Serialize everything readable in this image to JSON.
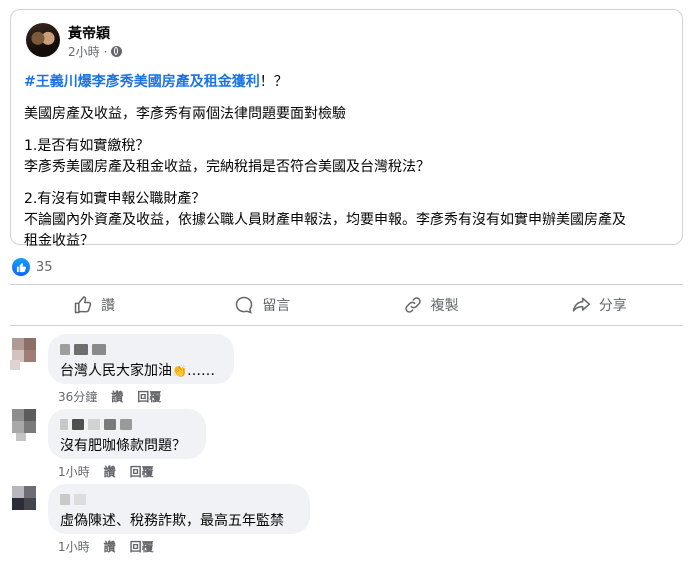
{
  "post": {
    "author": "黃帝穎",
    "time": "2小時",
    "dot": "·",
    "hashtag": "#王義川爆李彥秀美國房產及租金獲利",
    "hashtag_suffix": "！？",
    "paragraphs": [
      [
        "美國房產及收益，李彥秀有兩個法律問題要面對檢驗"
      ],
      [
        "1.是否有如實繳稅？",
        "李彥秀美國房產及租金收益，完納稅捐是否符合美國及台灣稅法？"
      ],
      [
        "2.有沒有如實申報公職財產？",
        "不論國內外資產及收益，依據公職人員財產申報法，均要申報。李彥秀有沒有如實申辦美國房產及",
        "租金收益？"
      ]
    ]
  },
  "reactions": {
    "count": "35"
  },
  "actions": {
    "like": "讚",
    "comment": "留言",
    "copy": "複製",
    "share": "分享"
  },
  "comments": [
    {
      "text": "台灣人民大家加油",
      "emoji": "👏",
      "ellipsis": "……",
      "time": "36分鐘",
      "like": "讚",
      "reply": "回覆"
    },
    {
      "text": "沒有肥咖條款問題？",
      "time": "1小時",
      "like": "讚",
      "reply": "回覆"
    },
    {
      "text": "虛偽陳述、稅務詐欺，最高五年監禁",
      "time": "1小時",
      "like": "讚",
      "reply": "回覆"
    }
  ],
  "colors": {
    "link": "#1b74e4",
    "secondary": "#65676b",
    "bubble": "#f0f2f5",
    "like": "#0866ff"
  }
}
